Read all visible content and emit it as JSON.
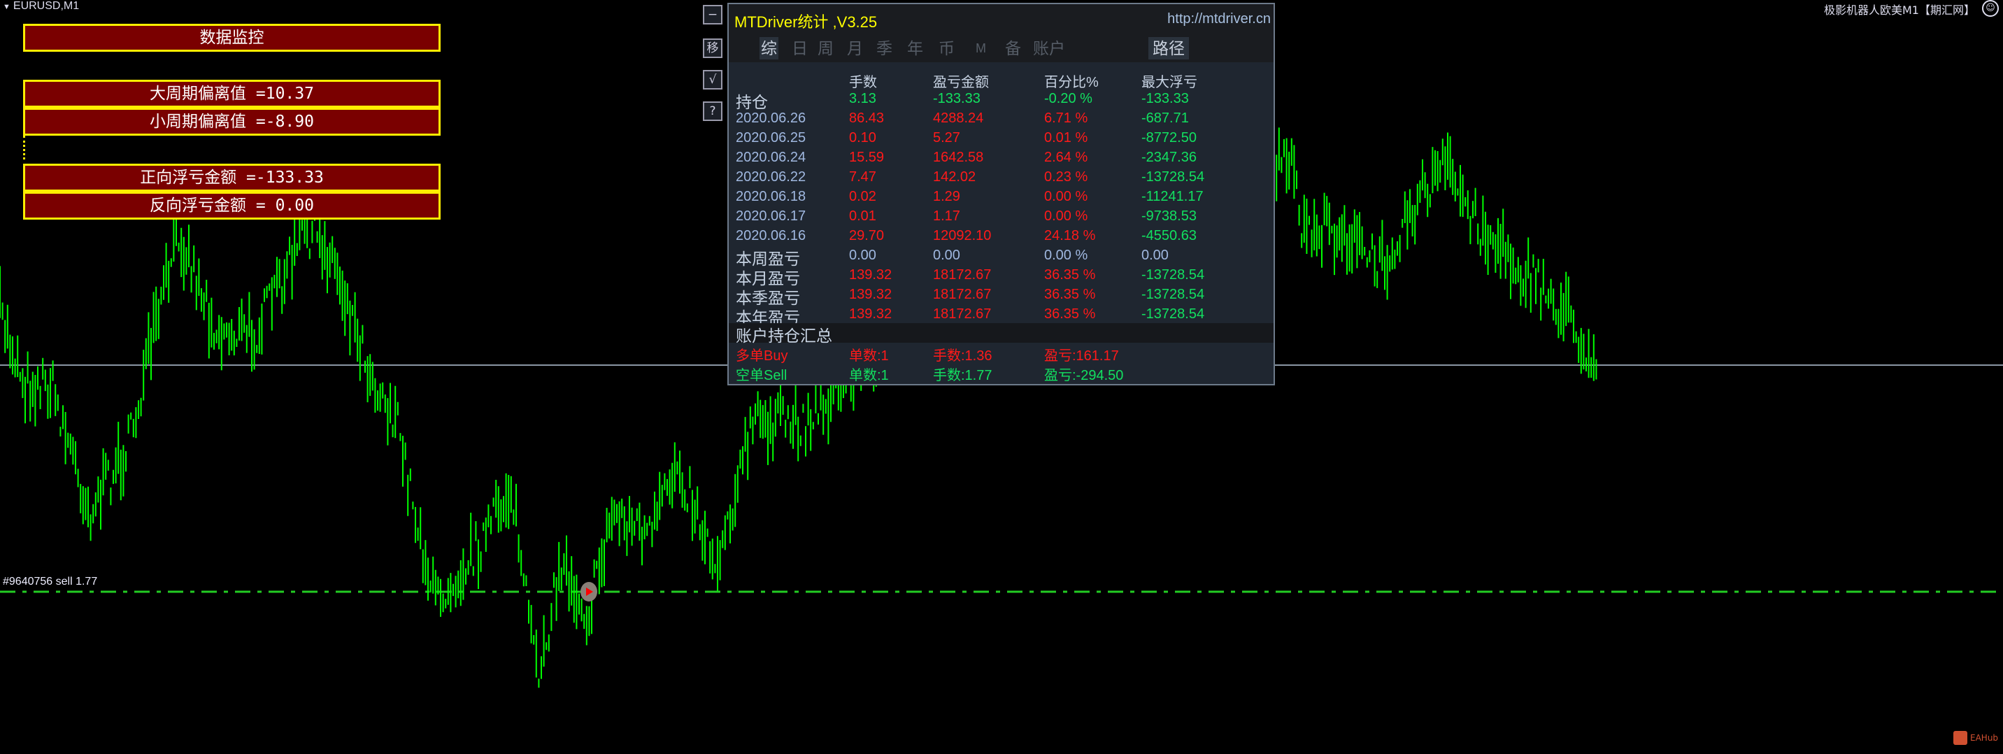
{
  "chart": {
    "symbol": "EURUSD,M1",
    "ea_title": "极影机器人欧美M1【期汇网】",
    "order_label": "#9640756 sell 1.77",
    "bar_color": "#00ff00",
    "watermark": "EAHub"
  },
  "monitor": {
    "title": "数据监控",
    "rows": [
      "大周期偏离值 =10.37",
      "小周期偏离值 =-8.90",
      "",
      "正向浮亏金额 =-133.33",
      "反向浮亏金额 = 0.00"
    ]
  },
  "side_buttons": [
    "−",
    "移",
    "√",
    "?"
  ],
  "panel": {
    "title": "MTDriver统计 ,V3.25",
    "url": "http://mtdriver.cn",
    "tabs": [
      "综",
      "日",
      "周",
      "月",
      "季",
      "年",
      "币",
      "M",
      "备",
      "账户",
      "路径"
    ],
    "active_tab": "综",
    "headers": [
      "手数",
      "盈亏金额",
      "百分比%",
      "最大浮亏"
    ],
    "rows": [
      {
        "label": "持仓",
        "lots": "3.13",
        "pnl": "-133.33",
        "pct": "-0.20 %",
        "maxdd": "-133.33"
      },
      {
        "label": "2020.06.26",
        "lots": "86.43",
        "pnl": "4288.24",
        "pct": "6.71 %",
        "maxdd": "-687.71"
      },
      {
        "label": "2020.06.25",
        "lots": "0.10",
        "pnl": "5.27",
        "pct": "0.01 %",
        "maxdd": "-8772.50"
      },
      {
        "label": "2020.06.24",
        "lots": "15.59",
        "pnl": "1642.58",
        "pct": "2.64 %",
        "maxdd": "-2347.36"
      },
      {
        "label": "2020.06.22",
        "lots": "7.47",
        "pnl": "142.02",
        "pct": "0.23 %",
        "maxdd": "-13728.54"
      },
      {
        "label": "2020.06.18",
        "lots": "0.02",
        "pnl": "1.29",
        "pct": "0.00 %",
        "maxdd": "-11241.17"
      },
      {
        "label": "2020.06.17",
        "lots": "0.01",
        "pnl": "1.17",
        "pct": "0.00 %",
        "maxdd": "-9738.53"
      },
      {
        "label": "2020.06.16",
        "lots": "29.70",
        "pnl": "12092.10",
        "pct": "24.18 %",
        "maxdd": "-4550.63"
      },
      {
        "label": "本周盈亏",
        "lots": "0.00",
        "pnl": "0.00",
        "pct": "0.00 %",
        "maxdd": "0.00"
      },
      {
        "label": "本月盈亏",
        "lots": "139.32",
        "pnl": "18172.67",
        "pct": "36.35 %",
        "maxdd": "-13728.54"
      },
      {
        "label": "本季盈亏",
        "lots": "139.32",
        "pnl": "18172.67",
        "pct": "36.35 %",
        "maxdd": "-13728.54"
      },
      {
        "label": "本年盈亏",
        "lots": "139.32",
        "pnl": "18172.67",
        "pct": "36.35 %",
        "maxdd": "-13728.54"
      }
    ],
    "summary_title": "账户持仓汇总",
    "buy": {
      "label": "多单Buy",
      "count": "单数:1",
      "lots": "手数:1.36",
      "pnl": "盈亏:161.17"
    },
    "sell": {
      "label": "空单Sell",
      "count": "单数:1",
      "lots": "手数:1.77",
      "pnl": "盈亏:-294.50"
    }
  }
}
